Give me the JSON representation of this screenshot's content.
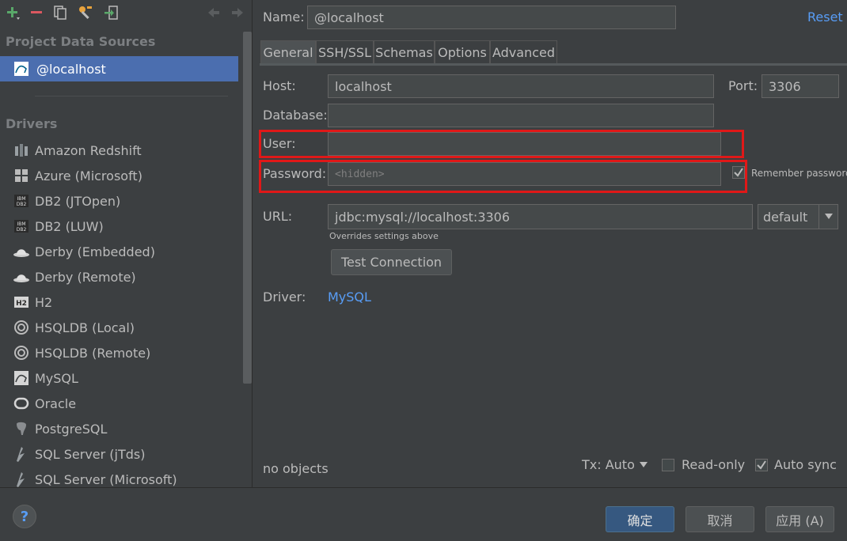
{
  "sidebar": {
    "project_header": "Project Data Sources",
    "selected_source": "@localhost",
    "drivers_header": "Drivers",
    "drivers": [
      {
        "label": "Amazon Redshift",
        "icon": "redshift-icon"
      },
      {
        "label": "Azure (Microsoft)",
        "icon": "windows-icon"
      },
      {
        "label": "DB2 (JTOpen)",
        "icon": "ibm-db2-icon"
      },
      {
        "label": "DB2 (LUW)",
        "icon": "ibm-db2-icon"
      },
      {
        "label": "Derby (Embedded)",
        "icon": "derby-hat-icon"
      },
      {
        "label": "Derby (Remote)",
        "icon": "derby-hat-icon"
      },
      {
        "label": "H2",
        "icon": "h2-icon"
      },
      {
        "label": "HSQLDB (Local)",
        "icon": "hsqldb-icon"
      },
      {
        "label": "HSQLDB (Remote)",
        "icon": "hsqldb-icon"
      },
      {
        "label": "MySQL",
        "icon": "mysql-icon"
      },
      {
        "label": "Oracle",
        "icon": "oracle-icon"
      },
      {
        "label": "PostgreSQL",
        "icon": "postgresql-icon"
      },
      {
        "label": "SQL Server (jTds)",
        "icon": "sqlserver-icon"
      },
      {
        "label": "SQL Server (Microsoft)",
        "icon": "sqlserver-icon"
      }
    ]
  },
  "header": {
    "name_label": "Name:",
    "name_value": "@localhost",
    "reset_label": "Reset"
  },
  "tabs": [
    {
      "label": "General",
      "active": true
    },
    {
      "label": "SSH/SSL",
      "active": false
    },
    {
      "label": "Schemas",
      "active": false
    },
    {
      "label": "Options",
      "active": false
    },
    {
      "label": "Advanced",
      "active": false
    }
  ],
  "form": {
    "host_label": "Host:",
    "host_value": "localhost",
    "port_label": "Port:",
    "port_value": "3306",
    "database_label": "Database:",
    "database_value": "",
    "user_label": "User:",
    "user_value": "",
    "password_label": "Password:",
    "password_placeholder": "<hidden>",
    "remember_password_label": "Remember password",
    "remember_password_checked": true,
    "url_label": "URL:",
    "url_value": "jdbc:mysql://localhost:3306",
    "url_mode": "default",
    "url_hint": "Overrides settings above",
    "test_connection_label": "Test Connection",
    "driver_label": "Driver:",
    "driver_value": "MySQL"
  },
  "status": {
    "objects_text": "no objects",
    "tx_label": "Tx: Auto",
    "readonly_label": "Read-only",
    "readonly_checked": false,
    "autosync_label": "Auto sync",
    "autosync_checked": true
  },
  "footer": {
    "help_label": "?",
    "ok_label": "确定",
    "cancel_label": "取消",
    "apply_label": "应用 (A)"
  },
  "colors": {
    "background": "#3c3f41",
    "selection": "#4b6eaf",
    "link": "#589df6",
    "highlight_box": "#e01818"
  }
}
